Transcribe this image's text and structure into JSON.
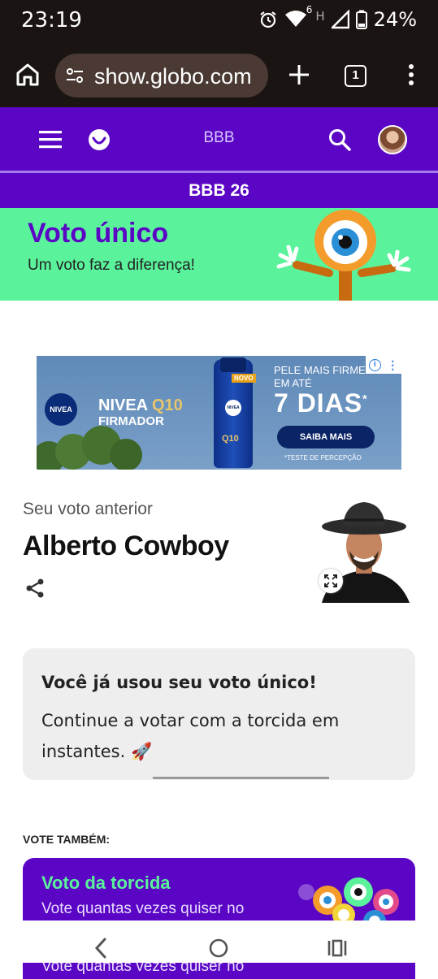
{
  "status_bar": {
    "time": "23:19",
    "network_label": "6",
    "network_type": "H",
    "battery": "24%"
  },
  "browser": {
    "url": "show.globo.com",
    "tab_count": "1"
  },
  "site_header": {
    "brand": "BBB",
    "section": "BBB 26"
  },
  "hero": {
    "title": "Voto único",
    "subtitle": "Um voto faz a diferença!"
  },
  "ad": {
    "brand": "NIVEA",
    "product_line1": "NIVEA",
    "product_q10": "Q10",
    "product_line2": "FIRMADOR",
    "badge": "NOVO",
    "bottle_q10": "Q10",
    "headline_top": "PELE MAIS FIRME",
    "headline_mid": "EM ATÉ",
    "headline_big": "7 DIAS",
    "headline_star": "*",
    "cta": "SAIBA MAIS",
    "disclaimer": "*TESTE DE PERCEPÇÃO"
  },
  "previous_vote": {
    "label": "Seu voto anterior",
    "name": "Alberto Cowboy"
  },
  "info_card": {
    "line1": "Você já usou seu voto único!",
    "line2": "Continue a votar com a torcida em instantes. 🚀"
  },
  "vote_also": {
    "heading": "VOTE TAMBÉM:",
    "card_title": "Voto da torcida",
    "card_subtitle": "Vote quantas vezes quiser no"
  },
  "colors": {
    "brand_purple": "#5a06c4",
    "hero_green": "#5af39b",
    "status_bg": "#1a1412"
  },
  "icons": [
    "alarm-icon",
    "wifi-icon",
    "signal-icon",
    "battery-icon",
    "home-icon",
    "site-settings-icon",
    "new-tab-icon",
    "tabs-icon",
    "more-icon",
    "hamburger-icon",
    "globo-logo-icon",
    "search-icon",
    "avatar",
    "share-icon",
    "expand-icon",
    "back-icon",
    "home-nav-icon",
    "recents-icon"
  ]
}
